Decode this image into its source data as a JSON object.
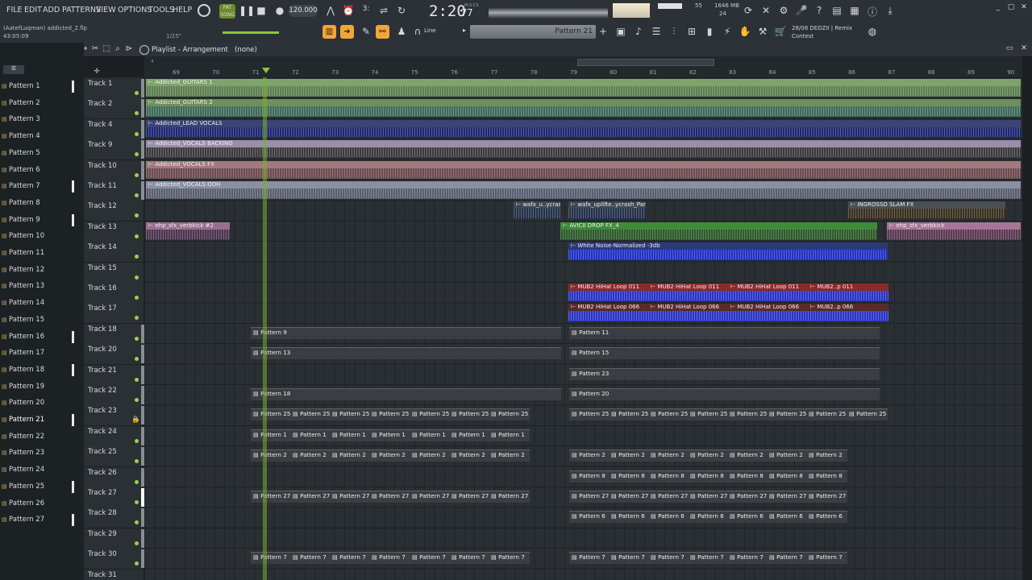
{
  "menu": [
    "FILE",
    "EDIT",
    "ADD",
    "PATTERNS",
    "VIEW",
    "OPTIONS",
    "TOOLS",
    "HELP"
  ],
  "transport": {
    "song_label": "SONG",
    "pat_label": "PAT",
    "tempo": "120.000",
    "time": "2:20",
    "time_sub": "77",
    "time_unit": "M:S:CS",
    "cpu": "55",
    "mem": "1646 MB",
    "mem_sub": "24",
    "hint": "28/08 DEDZII | Remix Contest"
  },
  "project": {
    "file": "(AatefLuqman) addicted_2.flp",
    "time": "43:05:09",
    "snap_hint": "1/25\""
  },
  "toolbar": {
    "snap_mode": "Line",
    "pattern_selector": "Pattern 21"
  },
  "playlist": {
    "title": "Playlist - Arrangement",
    "breadcrumb": "(none)"
  },
  "ruler": [
    "69",
    "70",
    "71",
    "72",
    "73",
    "74",
    "75",
    "76",
    "77",
    "78",
    "79",
    "80",
    "81",
    "82",
    "83",
    "84",
    "85",
    "86",
    "87",
    "88",
    "89",
    "90"
  ],
  "patterns": [
    "Pattern 1",
    "Pattern 2",
    "Pattern 3",
    "Pattern 4",
    "Pattern 5",
    "Pattern 6",
    "Pattern 7",
    "Pattern 8",
    "Pattern 9",
    "Pattern 10",
    "Pattern 11",
    "Pattern 12",
    "Pattern 13",
    "Pattern 14",
    "Pattern 15",
    "Pattern 16",
    "Pattern 17",
    "Pattern 18",
    "Pattern 19",
    "Pattern 20",
    "Pattern 21",
    "Pattern 22",
    "Pattern 23",
    "Pattern 24",
    "Pattern 25",
    "Pattern 26",
    "Pattern 27"
  ],
  "tracks": [
    "Track 1",
    "Track 2",
    "Track 4",
    "Track 9",
    "Track 10",
    "Track 11",
    "Track 12",
    "Track 13",
    "Track 14",
    "Track 15",
    "Track 16",
    "Track 17",
    "Track 18",
    "Track 20",
    "Track 21",
    "Track 22",
    "Track 23",
    "Track 24",
    "Track 25",
    "Track 26",
    "Track 27",
    "Track 28",
    "Track 29",
    "Track 30",
    "Track 31"
  ],
  "audio_clips": [
    "Addicted_GUITARS 1",
    "Addicted_GUITARS 2",
    "Addicted_LEAD VOCALS",
    "Addicted_VOCALS BACKING",
    "Addicted_VOCALS FX",
    "Addicted_VOCALS OOH",
    "wafx_u..ycrash",
    "wafx_uplifte..ycrash_Part 2",
    "INGROSSO SLAM FX",
    "ehp_sfx_verbkick #2",
    "AVICII DROP FX_4",
    "ehp_sfx_verbkick",
    "White Noise-Normalized -3db",
    "MUB2 HiHat Loop 011",
    "MUB2 HiHat Loop 011",
    "MUB2 HiHat Loop 011",
    "MUB2..p 011",
    "MUB2 HiHat Loop 066",
    "MUB2 HiHat Loop 066",
    "MUB2 HiHat Loop 066",
    "MUB2..p 066"
  ],
  "pattern_clips": [
    "Pattern 9",
    "Pattern 11",
    "Pattern 13",
    "Pattern 15",
    "Pattern 23",
    "Pattern 18",
    "Pattern 20",
    "Pattern 25",
    "Pattern 1",
    "Pattern 2",
    "Pattern 8",
    "Pattern 27",
    "Pattern 6",
    "Pattern 7"
  ],
  "colors": {
    "accent": "#f0a63c",
    "guitars": "#7ea36b",
    "vocals": "#9a8fa8",
    "blue": "#3a4fd0",
    "green": "#4a9a3a",
    "red": "#a23b3b",
    "playhead": "#8dc63f"
  }
}
